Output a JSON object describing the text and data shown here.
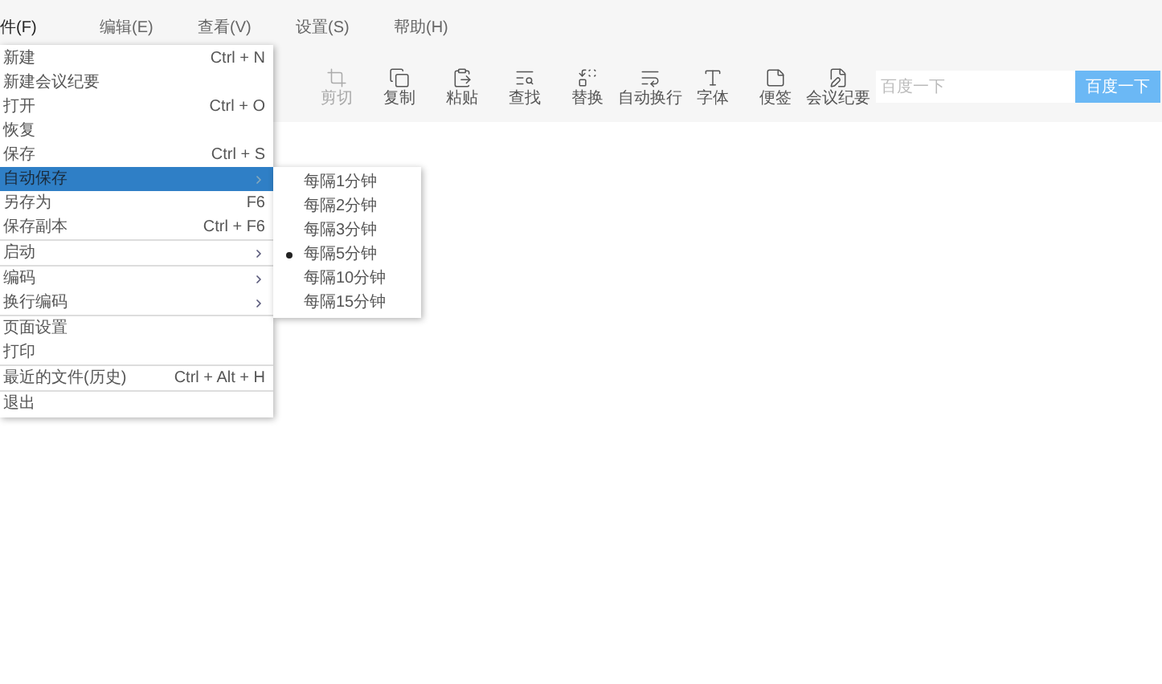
{
  "menubar": [
    {
      "label": "件(F)",
      "selected": true
    },
    {
      "label": "编辑(E)",
      "selected": false
    },
    {
      "label": "查看(V)",
      "selected": false
    },
    {
      "label": "设置(S)",
      "selected": false
    },
    {
      "label": "帮助(H)",
      "selected": false
    }
  ],
  "toolbar": [
    {
      "kind": "crop",
      "label": "剪切",
      "disabled": true
    },
    {
      "kind": "copy",
      "label": "复制",
      "disabled": false
    },
    {
      "kind": "paste",
      "label": "粘贴",
      "disabled": false
    },
    {
      "kind": "find",
      "label": "查找",
      "disabled": false
    },
    {
      "kind": "replace",
      "label": "替换",
      "disabled": false
    },
    {
      "kind": "wrap",
      "label": "自动换行",
      "disabled": false
    },
    {
      "kind": "font",
      "label": "字体",
      "disabled": false
    },
    {
      "kind": "note",
      "label": "便签",
      "disabled": false
    },
    {
      "kind": "minutes",
      "label": "会议纪要",
      "disabled": false
    }
  ],
  "search": {
    "placeholder": "百度一下",
    "button": "百度一下"
  },
  "file_menu": [
    {
      "label": "新建",
      "shortcut": "Ctrl + N",
      "submenu": false,
      "separator_before": false,
      "selected": false
    },
    {
      "label": "新建会议纪要",
      "submenu": false,
      "separator_before": false,
      "selected": false
    },
    {
      "label": "打开",
      "shortcut": "Ctrl + O",
      "submenu": false,
      "separator_before": false,
      "selected": false
    },
    {
      "label": "恢复",
      "submenu": false,
      "separator_before": false,
      "selected": false
    },
    {
      "label": "保存",
      "shortcut": "Ctrl + S",
      "submenu": false,
      "separator_before": false,
      "selected": false
    },
    {
      "label": "自动保存",
      "submenu": true,
      "separator_before": false,
      "selected": true
    },
    {
      "label": "另存为",
      "shortcut": "F6",
      "submenu": false,
      "separator_before": false,
      "selected": false
    },
    {
      "label": "保存副本",
      "shortcut": "Ctrl + F6",
      "submenu": false,
      "separator_before": false,
      "selected": false
    },
    {
      "label": "启动",
      "submenu": true,
      "separator_before": true,
      "selected": false
    },
    {
      "label": "编码",
      "submenu": true,
      "separator_before": true,
      "selected": false
    },
    {
      "label": "换行编码",
      "submenu": true,
      "separator_before": false,
      "selected": false
    },
    {
      "label": "页面设置",
      "submenu": false,
      "separator_before": true,
      "selected": false
    },
    {
      "label": "打印",
      "submenu": false,
      "separator_before": false,
      "selected": false
    },
    {
      "label": "最近的文件(历史)",
      "shortcut": "Ctrl + Alt + H",
      "submenu": false,
      "separator_before": true,
      "selected": false
    },
    {
      "label": "退出",
      "submenu": false,
      "separator_before": true,
      "selected": false
    }
  ],
  "autosave_menu": [
    {
      "label": "每隔1分钟",
      "selected": false
    },
    {
      "label": "每隔2分钟",
      "selected": false
    },
    {
      "label": "每隔3分钟",
      "selected": false
    },
    {
      "label": "每隔5分钟",
      "selected": true
    },
    {
      "label": "每隔10分钟",
      "selected": false
    },
    {
      "label": "每隔15分钟",
      "selected": false
    }
  ]
}
